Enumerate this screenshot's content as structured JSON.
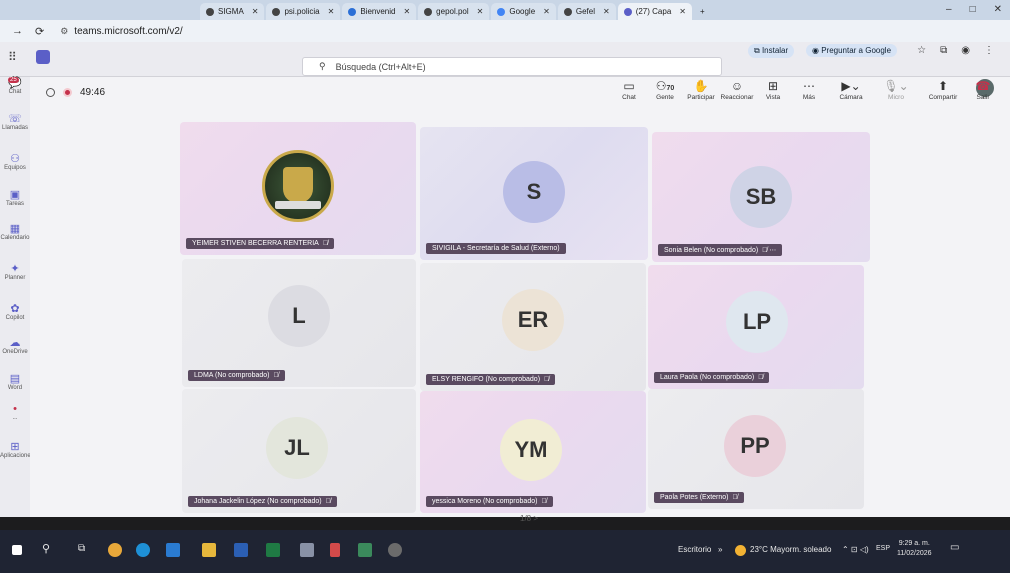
{
  "browser": {
    "tabs": [
      {
        "label": "SIGMA",
        "active": false
      },
      {
        "label": "psi.policia",
        "active": false
      },
      {
        "label": "Bienvenid",
        "active": false
      },
      {
        "label": "gepol.pol",
        "active": false
      },
      {
        "label": "Google",
        "active": false
      },
      {
        "label": "Gefel",
        "active": false
      },
      {
        "label": "(27) Capa",
        "active": true
      }
    ],
    "new_tab": "+",
    "url": "teams.microsoft.com/v2/",
    "install_label": "Instalar",
    "ask_google_label": "Preguntar a Google"
  },
  "teams": {
    "search_placeholder": "Búsqueda (Ctrl+Alt+E)",
    "rail": [
      {
        "label": "Chat",
        "icon": "chat-icon",
        "badge": "25"
      },
      {
        "label": "Llamadas",
        "icon": "calls-icon"
      },
      {
        "label": "Equipos",
        "icon": "teams-icon"
      },
      {
        "label": "Tareas",
        "icon": "tasks-icon"
      },
      {
        "label": "Calendario",
        "icon": "calendar-icon"
      },
      {
        "label": "Planner",
        "icon": "planner-icon"
      },
      {
        "label": "Copilot",
        "icon": "copilot-icon"
      },
      {
        "label": "OneDrive",
        "icon": "onedrive-icon"
      },
      {
        "label": "Word",
        "icon": "word-icon"
      },
      {
        "label": "...",
        "icon": "more-icon"
      },
      {
        "label": "Aplicaciones",
        "icon": "apps-icon"
      }
    ]
  },
  "meeting": {
    "timer": "49:46",
    "toolbar": [
      {
        "label": "Chat",
        "icon": "chat-icon"
      },
      {
        "label": "Gente",
        "icon": "people-icon",
        "count": "70"
      },
      {
        "label": "Participar",
        "icon": "raise-hand-icon"
      },
      {
        "label": "Reaccionar",
        "icon": "emoji-icon"
      },
      {
        "label": "Vista",
        "icon": "view-icon"
      },
      {
        "label": "Más",
        "icon": "more-icon"
      },
      {
        "label": "Cámara",
        "icon": "camera-icon"
      },
      {
        "label": "Micro",
        "icon": "mic-icon"
      },
      {
        "label": "Compartir",
        "icon": "share-icon"
      }
    ],
    "leave_label": "Salir",
    "participants": [
      {
        "name": "YEIMER STIVEN BECERRA RENTERIA",
        "initials": "",
        "has_seal": true,
        "mic": "muted"
      },
      {
        "name": "SIVIGILA - Secretaría de Salud (Externo)",
        "initials": "S",
        "mic": "none"
      },
      {
        "name": "Sonia Belen (No comprobado)",
        "initials": "SB",
        "mic": "muted"
      },
      {
        "name": "LDMA (No comprobado)",
        "initials": "L",
        "mic": "muted"
      },
      {
        "name": "ELSY RENGIFO (No comprobado)",
        "initials": "ER",
        "mic": "muted"
      },
      {
        "name": "Laura Paola (No comprobado)",
        "initials": "LP",
        "mic": "muted"
      },
      {
        "name": "Johana Jackelin López (No comprobado)",
        "initials": "JL",
        "mic": "muted"
      },
      {
        "name": "yessica Moreno (No comprobado)",
        "initials": "YM",
        "mic": "muted"
      },
      {
        "name": "Paola Potes (Externo)",
        "initials": "PP",
        "mic": "muted"
      }
    ],
    "pager": "1/8 >"
  },
  "taskbar": {
    "desktop_label": "Escritorio",
    "weather": "23°C Mayorm. soleado",
    "lang": "ESP",
    "time": "9:29 a. m.",
    "date": "11/02/2026"
  },
  "colors": {
    "teams_purple": "#5b5fc7",
    "leave_red": "#c4314b",
    "tile_pink": "#ead9ef",
    "taskbar": "#1f2433"
  }
}
